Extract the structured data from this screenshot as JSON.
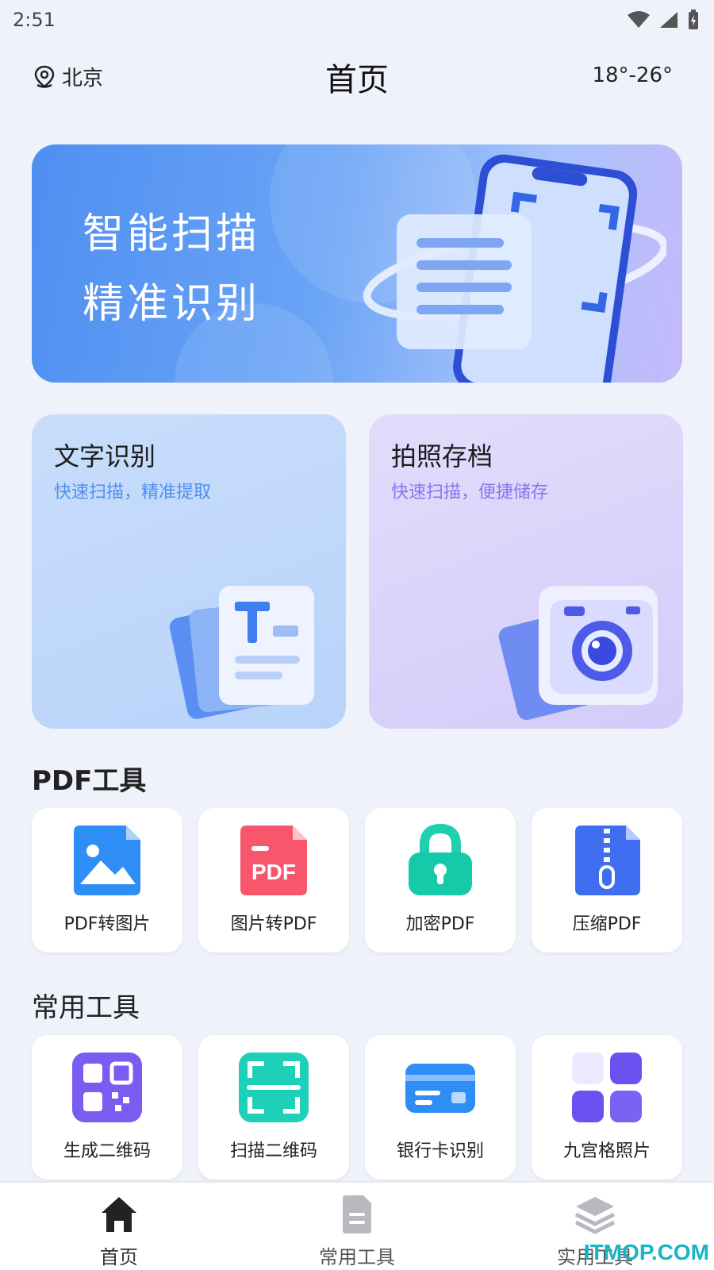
{
  "status_bar": {
    "time": "2:51"
  },
  "header": {
    "location": "北京",
    "title": "首页",
    "weather": "18°-26°"
  },
  "banner": {
    "line1": "智能扫描",
    "line2": "精准识别"
  },
  "feature_cards": [
    {
      "title": "文字识别",
      "subtitle": "快速扫描，精准提取"
    },
    {
      "title": "拍照存档",
      "subtitle": "快速扫描，便捷储存"
    }
  ],
  "pdf_tools": {
    "title": "PDF工具",
    "items": [
      {
        "label": "PDF转图片",
        "icon": "image-file-icon"
      },
      {
        "label": "图片转PDF",
        "icon": "pdf-file-icon"
      },
      {
        "label": "加密PDF",
        "icon": "lock-icon"
      },
      {
        "label": "压缩PDF",
        "icon": "zip-file-icon"
      }
    ]
  },
  "common_tools": {
    "title": "常用工具",
    "items": [
      {
        "label": "生成二维码",
        "icon": "qr-code-icon"
      },
      {
        "label": "扫描二维码",
        "icon": "scan-frame-icon"
      },
      {
        "label": "银行卡识别",
        "icon": "bank-card-icon"
      },
      {
        "label": "九宫格照片",
        "icon": "grid-icon"
      }
    ]
  },
  "bottom_nav": [
    {
      "label": "首页",
      "icon": "home-icon",
      "active": true
    },
    {
      "label": "常用工具",
      "icon": "document-icon",
      "active": false
    },
    {
      "label": "实用工具",
      "icon": "layers-icon",
      "active": false
    }
  ],
  "watermark": "ITMOP.COM",
  "colors": {
    "accent_blue": "#4f8ff2",
    "accent_purple": "#8a74ee",
    "background": "#f0f2fb"
  }
}
